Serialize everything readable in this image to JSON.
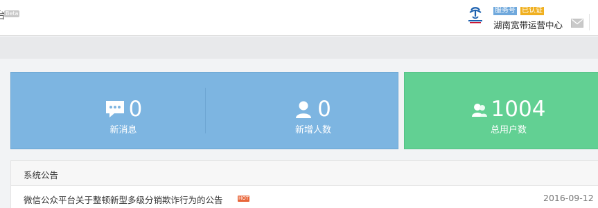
{
  "header": {
    "logo_fragment": "台",
    "beta_badge": "Beta",
    "account": {
      "brand_icon": "china-telecom-logo",
      "service_badge": "服务号",
      "verified_badge": "已认证",
      "name": "湖南宽带运营中心",
      "mail_icon": "mail-icon"
    }
  },
  "stats": {
    "new_messages": {
      "value": "0",
      "label": "新消息",
      "icon": "chat-bubble-icon"
    },
    "new_followers": {
      "value": "0",
      "label": "新增人数",
      "icon": "person-icon"
    },
    "total_users": {
      "value": "1004",
      "label": "总用户数",
      "icon": "users-icon"
    }
  },
  "announcements": {
    "title": "系统公告",
    "items": [
      {
        "title": "微信公众平台关于整顿新型多级分销欺诈行为的公告",
        "tag": "HOT",
        "date": "2016-09-12"
      }
    ]
  },
  "colors": {
    "panel_blue": "#7db5e1",
    "panel_green": "#62d093",
    "service_badge": "#6fa8dc",
    "verified_badge": "#f0b020",
    "hot_tag": "#e8663a"
  }
}
